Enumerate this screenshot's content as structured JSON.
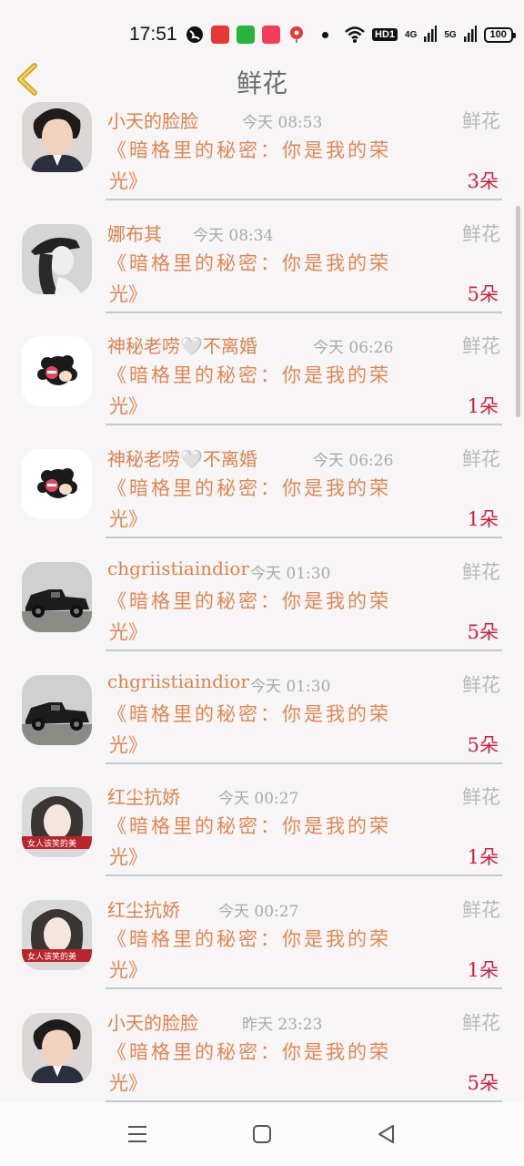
{
  "status": {
    "time": "17:51",
    "net4g": "4G",
    "net5g": "5G",
    "hd": "HD1",
    "battery": "100"
  },
  "header": {
    "title": "鲜花"
  },
  "rows": [
    {
      "name": "小天的脸脸",
      "time": "今天 08:53",
      "tag": "鲜花",
      "line1": "《暗格里的秘密：你是我的荣",
      "line2": "光》",
      "count": "3朵"
    },
    {
      "name": "娜布其",
      "time": "今天 08:34",
      "tag": "鲜花",
      "line1": "《暗格里的秘密：你是我的荣",
      "line2": "光》",
      "count": "5朵"
    },
    {
      "name": "神秘老唠🤍不离婚",
      "time": "今天 06:26",
      "tag": "鲜花",
      "line1": "《暗格里的秘密：你是我的荣",
      "line2": "光》",
      "count": "1朵"
    },
    {
      "name": "神秘老唠🤍不离婚",
      "time": "今天 06:26",
      "tag": "鲜花",
      "line1": "《暗格里的秘密：你是我的荣",
      "line2": "光》",
      "count": "1朵"
    },
    {
      "name": "chgriistiaindior",
      "time": "今天 01:30",
      "tag": "鲜花",
      "line1": "《暗格里的秘密：你是我的荣",
      "line2": "光》",
      "count": "5朵"
    },
    {
      "name": "chgriistiaindior",
      "time": "今天 01:30",
      "tag": "鲜花",
      "line1": "《暗格里的秘密：你是我的荣",
      "line2": "光》",
      "count": "5朵"
    },
    {
      "name": "红尘抗娇",
      "time": "今天 00:27",
      "tag": "鲜花",
      "line1": "《暗格里的秘密：你是我的荣",
      "line2": "光》",
      "count": "1朵"
    },
    {
      "name": "红尘抗娇",
      "time": "今天 00:27",
      "tag": "鲜花",
      "line1": "《暗格里的秘密：你是我的荣",
      "line2": "光》",
      "count": "1朵"
    },
    {
      "name": "小天的脸脸",
      "time": "昨天 23:23",
      "tag": "鲜花",
      "line1": "《暗格里的秘密：你是我的荣",
      "line2": "光》",
      "count": "5朵"
    }
  ],
  "avatars": [
    "man-portrait",
    "girl-cap",
    "cartoon-headphones",
    "cartoon-headphones",
    "vintage-car",
    "vintage-car",
    "woman-portrait",
    "woman-portrait",
    "man-portrait"
  ],
  "colors": {
    "name": "#d9834e",
    "message": "#e08752",
    "count": "#c8243c",
    "time": "#a9a9a9",
    "back": "#d4aa24"
  }
}
